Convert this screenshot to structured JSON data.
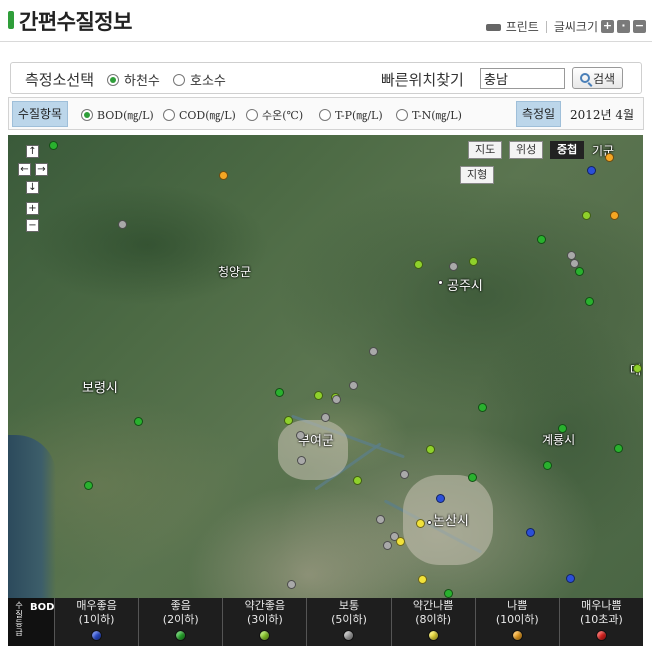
{
  "header": {
    "title": "간편수질정보",
    "print_label": "프린트",
    "fontsize_label": "글씨크기"
  },
  "search": {
    "station_select_label": "측정소선택",
    "station_options": [
      {
        "label": "하천수",
        "selected": true
      },
      {
        "label": "호소수",
        "selected": false
      }
    ],
    "quick_find_label": "빠른위치찾기",
    "quick_find_value": "충남",
    "search_button": "검색"
  },
  "params": {
    "label": "수질항목",
    "options": [
      {
        "label": "BOD(㎎/L)",
        "selected": true
      },
      {
        "label": "COD(㎎/L)",
        "selected": false
      },
      {
        "label": "수온(℃)",
        "selected": false
      },
      {
        "label": "T-P(㎎/L)",
        "selected": false
      },
      {
        "label": "T-N(㎎/L)",
        "selected": false
      }
    ],
    "date_label": "측정일",
    "date_value": "2012년 4월"
  },
  "map": {
    "types": [
      "지도",
      "위성",
      "중첩",
      "지형"
    ],
    "active_type": "중첩",
    "place_labels": [
      "청양군",
      "공주시",
      "보령시",
      "부여군",
      "계룡시",
      "논산시",
      "기군",
      "대"
    ]
  },
  "legend": {
    "vertical_label": "수질등급",
    "parameter": "BOD",
    "items": [
      {
        "label": "매우좋음",
        "range": "(1이하)",
        "color": "#2b4fd8"
      },
      {
        "label": "좋음",
        "range": "(2이하)",
        "color": "#29b12e"
      },
      {
        "label": "약간좋음",
        "range": "(3이하)",
        "color": "#8fd12b"
      },
      {
        "label": "보통",
        "range": "(5이하)",
        "color": "#a9a9a9"
      },
      {
        "label": "약간나쁨",
        "range": "(8이하)",
        "color": "#f2e23a"
      },
      {
        "label": "나쁨",
        "range": "(10이하)",
        "color": "#f5a623"
      },
      {
        "label": "매우나쁨",
        "range": "(10초과)",
        "color": "#e8231f"
      }
    ]
  }
}
